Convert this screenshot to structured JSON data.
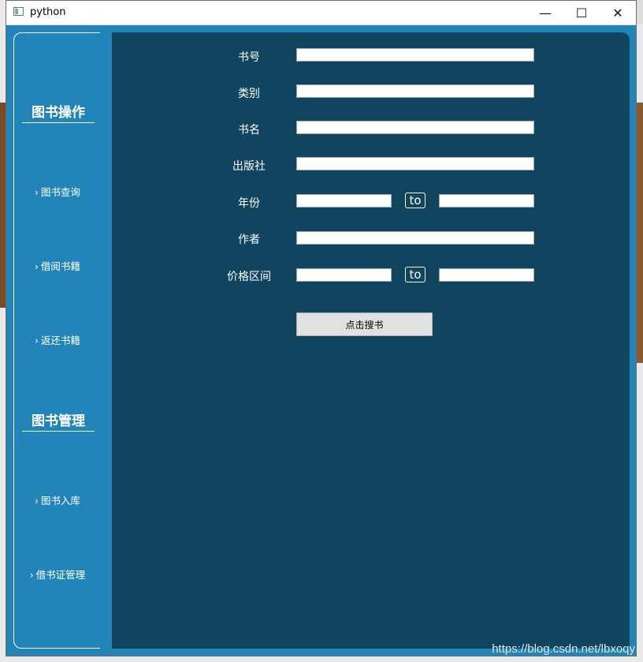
{
  "window": {
    "title": "python"
  },
  "controls": {
    "minimize": "—",
    "maximize": "☐",
    "close": "✕"
  },
  "sidebar": {
    "section1": "图书操作",
    "items1": [
      "图书查询",
      "借阅书籍",
      "返还书籍"
    ],
    "section2": "图书管理",
    "items2": [
      "图书入库",
      "借书证管理"
    ],
    "chevron": "›"
  },
  "form": {
    "book_no": "书号",
    "category": "类别",
    "title": "书名",
    "publisher": "出版社",
    "year": "年份",
    "author": "作者",
    "price_range": "价格区间",
    "to_label": "to",
    "search_button": "点击搜书"
  },
  "watermark": "https://blog.csdn.net/lbxoqy"
}
